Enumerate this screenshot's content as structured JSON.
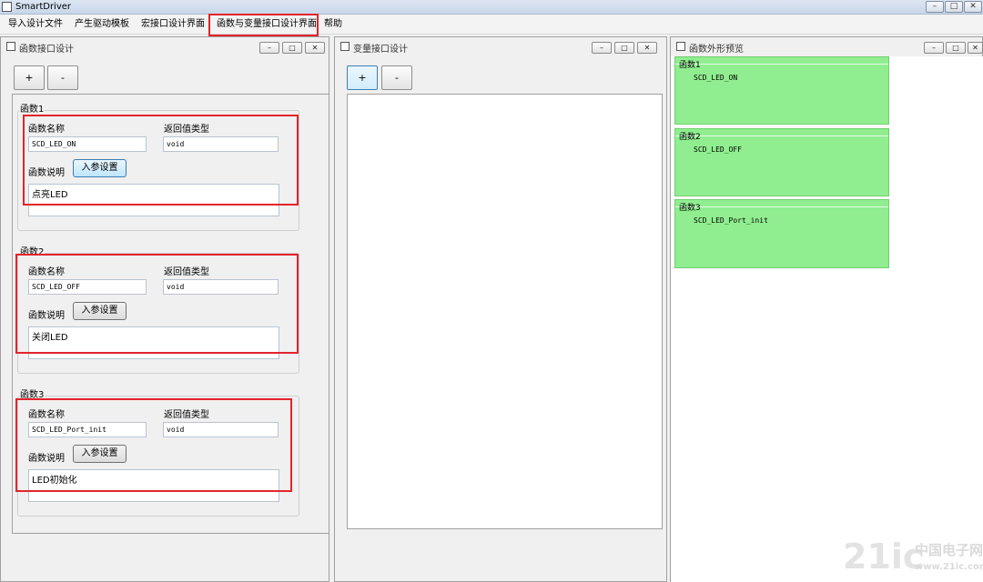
{
  "window": {
    "title": "SmartDriver"
  },
  "menu": [
    "导入设计文件",
    "产生驱动模板",
    "宏接口设计界面",
    "函数与变量接口设计界面",
    "帮助"
  ],
  "left_panel": {
    "title": "函数接口设计",
    "add_label": "+",
    "remove_label": "-",
    "functions": [
      {
        "group": "函数1",
        "name_label": "函数名称",
        "name": "SCD_LED_ON",
        "return_label": "返回值类型",
        "return_type": "void",
        "desc_label": "函数说明",
        "param_button": "入参设置",
        "description": "点亮LED"
      },
      {
        "group": "函数2",
        "name_label": "函数名称",
        "name": "SCD_LED_OFF",
        "return_label": "返回值类型",
        "return_type": "void",
        "desc_label": "函数说明",
        "param_button": "入参设置",
        "description": "关闭LED"
      },
      {
        "group": "函数3",
        "name_label": "函数名称",
        "name": "SCD_LED_Port_init",
        "return_label": "返回值类型",
        "return_type": "void",
        "desc_label": "函数说明",
        "param_button": "入参设置",
        "description": "LED初始化"
      }
    ]
  },
  "middle_panel": {
    "title": "变量接口设计",
    "add_label": "+",
    "remove_label": "-"
  },
  "right_panel": {
    "title": "函数外形预览",
    "previews": [
      {
        "label": "函数1",
        "name": "SCD_LED_ON"
      },
      {
        "label": "函数2",
        "name": "SCD_LED_OFF"
      },
      {
        "label": "函数3",
        "name": "SCD_LED_Port_init"
      }
    ]
  },
  "window_controls": {
    "minimize": "–",
    "maximize": "□",
    "close": "✕"
  },
  "watermark": {
    "logo": "21ic",
    "cn": "中国电子网",
    "url": "www.21ic.com"
  },
  "colors": {
    "highlight": "#e2242c",
    "preview_bg": "#90ee90"
  }
}
